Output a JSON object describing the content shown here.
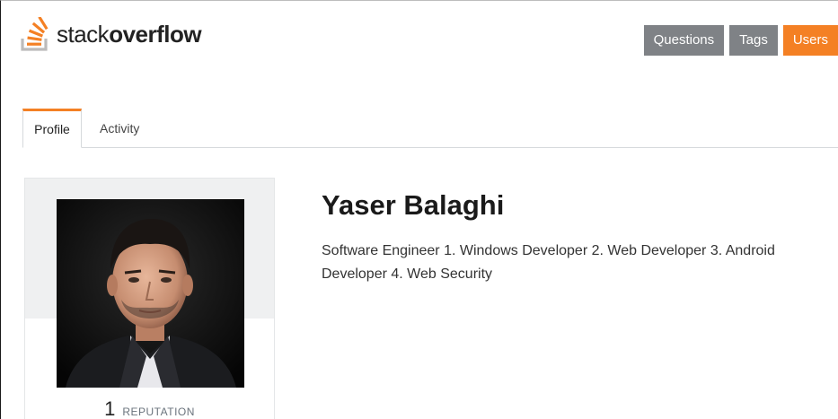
{
  "header": {
    "logo": {
      "text_light": "stack",
      "text_bold": "overflow",
      "icon": "stackoverflow-logo-icon"
    },
    "nav": [
      {
        "label": "Questions",
        "active": false
      },
      {
        "label": "Tags",
        "active": false
      },
      {
        "label": "Users",
        "active": true
      }
    ]
  },
  "tabs": [
    {
      "label": "Profile",
      "active": true
    },
    {
      "label": "Activity",
      "active": false
    }
  ],
  "profile": {
    "name": "Yaser Balaghi",
    "bio": "Software Engineer 1. Windows Developer 2. Web Developer 3. Android Developer 4. Web Security",
    "reputation": "1",
    "reputation_label": "REPUTATION"
  },
  "colors": {
    "accent": "#f48024",
    "nav_inactive": "#7f8286",
    "card_bg": "#eff0f1"
  }
}
